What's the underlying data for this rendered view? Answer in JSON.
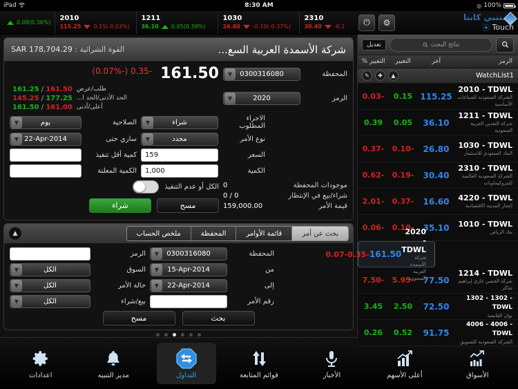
{
  "status_bar": {
    "device": "iPad",
    "wifi_icon": "wifi-icon",
    "time": "8:30 AM",
    "battery_text": "100%",
    "location_icon": "location-icon"
  },
  "ticker": {
    "items": [
      {
        "symbol": "",
        "last": "",
        "change": "0.08(0.36%)",
        "dir": "up"
      },
      {
        "symbol": "2010",
        "last": "115.25",
        "change": "0.15(-0.03%)",
        "dir": "down"
      },
      {
        "symbol": "1211",
        "last": "36.10",
        "change": "0.05(0.39%)",
        "dir": "up"
      },
      {
        "symbol": "1030",
        "last": "26.80",
        "change": "-0.10(-0.37%)",
        "dir": "down"
      },
      {
        "symbol": "2310",
        "last": "30.40",
        "change": "-0.1",
        "dir": "down"
      }
    ],
    "power_button": "⏻",
    "settings_button": "⚙",
    "brand_line1": "المتنبي كابنا",
    "brand_line2": "Touch"
  },
  "order_panel": {
    "title": "شركة الأسمدة العربية السع...",
    "buying_power_label": "القوة الشرائية :",
    "buying_power_value": "SAR 178,704.29",
    "quote": {
      "last": "161.50",
      "change": "-0.35 (-0.07%)",
      "bid_ask_label": "طلب/عرض",
      "bid": "161.25",
      "ask": "161.50",
      "limit_label": "الحد الأدنى/الحد ا...",
      "limit_low": "145.25",
      "limit_high": "177.25",
      "highlow_label": "أعلى/أدنى",
      "high": "161.50",
      "low": "161.00"
    },
    "fields": {
      "portfolio_label": "المحفظة",
      "portfolio_value": "0300316080",
      "symbol_label": "الرمز",
      "symbol_value": "2020",
      "action_label": "الاجراء المطلوب",
      "action_value": "شراء",
      "validity_label": "الصلاحية",
      "validity_value": "يوم",
      "order_type_label": "نوع الأمر",
      "order_type_value": "محدد",
      "valid_until_label": "ساري حتى",
      "valid_until_value": "22-Apr-2014",
      "price_label": "السعر",
      "price_value": "159",
      "min_qty_label": "كمية أقل تنفيذ",
      "min_qty_value": "",
      "qty_label": "الكمية",
      "qty_value": "1,000",
      "disclosed_qty_label": "الكمية المعلنة",
      "disclosed_qty_value": "",
      "all_or_none_label": "الكل أو عدم التنفيذ"
    },
    "summary": {
      "holdings_label": "موجودات المحفظة",
      "holdings_value": "0",
      "pending_label": "شراء/بيع في الإنتظار",
      "pending_value": "0 / 0",
      "order_value_label": "قيمة الأمر",
      "order_value_value": "159,000.00"
    },
    "buy_button": "شراء",
    "clear_button": "مسح"
  },
  "lower_panel": {
    "collapse_icon": "chevron-up-icon",
    "tabs": [
      {
        "label": "بحث عن أمر",
        "active": true
      },
      {
        "label": "قائمة الأوامر",
        "active": false
      },
      {
        "label": "المحفظة",
        "active": false
      },
      {
        "label": "ملخص الحساب",
        "active": false
      }
    ],
    "search": {
      "portfolio_label": "المحفظة",
      "portfolio_value": "0300316080",
      "symbol_label": "الرمز",
      "symbol_value": "",
      "from_label": "من",
      "from_value": "15-Apr-2014",
      "market_label": "السوق",
      "market_value": "الكل",
      "to_label": "إلى",
      "to_value": "22-Apr-2014",
      "status_label": "حالة الأمر",
      "status_value": "الكل",
      "order_no_label": "رقم الأمر",
      "order_no_value": "",
      "side_label": "بيع/شراء",
      "side_value": "الكل",
      "search_button": "بحث",
      "clear_button": "مسح"
    },
    "page_dots": {
      "count": 6,
      "active_index": 2
    }
  },
  "watchlist": {
    "search_icon": "search-icon",
    "search_placeholder": "نتائج البحث",
    "edit_button": "تعديل",
    "columns": {
      "symbol": "الرمز",
      "last": "آخر",
      "change": "التغيير",
      "change_pct": "التغيير %"
    },
    "group_name": "WatchList1",
    "group_icons": [
      "edit-pencil-icon",
      "plus-icon",
      "chevron-up-icon"
    ],
    "rows": [
      {
        "symbol": "2010 - TDWL",
        "name": "الشركة السعودية للصناعات الأساسية",
        "last": "115.25",
        "change": "0.15",
        "change_pct": "-0.03",
        "change_dir": "up",
        "pct_dir": "down",
        "selected": false
      },
      {
        "symbol": "1211 - TDWL",
        "name": "شركة التعدين العربية السعودية",
        "last": "36.10",
        "change": "0.05",
        "change_pct": "0.39",
        "change_dir": "up",
        "pct_dir": "up",
        "selected": false
      },
      {
        "symbol": "1030 - TDWL",
        "name": "البنك السعودي للاستثمار",
        "last": "26.80",
        "change": "-0.10",
        "change_pct": "-0.37",
        "change_dir": "down",
        "pct_dir": "down",
        "selected": false
      },
      {
        "symbol": "2310 - TDWL",
        "name": "الشركة السعودية العالمية للبتروكيماويات",
        "last": "30.40",
        "change": "-0.19",
        "change_pct": "-0.62",
        "change_dir": "down",
        "pct_dir": "down",
        "selected": false
      },
      {
        "symbol": "4220 - TDWL",
        "name": "إعمار المدينة الاقتصادية",
        "last": "16.60",
        "change": "-0.37",
        "change_pct": "-2.01",
        "change_dir": "down",
        "pct_dir": "down",
        "selected": false
      },
      {
        "symbol": "1010 - TDWL",
        "name": "بنك الرياض",
        "last": "35.10",
        "change": "-0.10",
        "change_pct": "-0.06",
        "change_dir": "down",
        "pct_dir": "down",
        "selected": false
      },
      {
        "symbol": "2020 - TDWL",
        "name": "شركة الأسمدة العربية السعودية",
        "last": "161.50",
        "change": "-0.35",
        "change_pct": "-0.07",
        "change_dir": "down",
        "pct_dir": "down",
        "selected": true
      },
      {
        "symbol": "1214 - TDWL",
        "name": "شركة الحسن غازي إبراهيم شاكر",
        "last": "77.50",
        "change": "-5.95",
        "change_pct": "-7.50",
        "change_dir": "down",
        "pct_dir": "down",
        "selected": false
      },
      {
        "symbol": "1302 - 1302 - TDWL",
        "name": "بوان القابضة",
        "last": "72.50",
        "change": "2.50",
        "change_pct": "3.45",
        "change_dir": "up",
        "pct_dir": "up",
        "selected": false
      },
      {
        "symbol": "4006 - 4006 - TDWL",
        "name": "الشركة السعودية للتسويق",
        "last": "91.75",
        "change": "0.52",
        "change_pct": "0.26",
        "change_dir": "up",
        "pct_dir": "up",
        "selected": false
      }
    ]
  },
  "bottom_nav": [
    {
      "label": "اعدادات",
      "icon": "gear-icon",
      "active": false
    },
    {
      "label": "مدير التنبيه",
      "icon": "bell-icon",
      "active": false
    },
    {
      "label": "التداول",
      "icon": "trade-arrows-icon",
      "active": true
    },
    {
      "label": "قوائم المتابعة",
      "icon": "up-down-arrows-icon",
      "active": false
    },
    {
      "label": "الأخبار",
      "icon": "microphone-icon",
      "active": false
    },
    {
      "label": "أعلى الأسهم",
      "icon": "bar-chart-up-icon",
      "active": false
    },
    {
      "label": "الأسواق",
      "icon": "market-chart-icon",
      "active": false
    }
  ],
  "colors": {
    "up": "#17b317",
    "down": "#d32222",
    "price_blue": "#2f86e8",
    "accent": "#3ba0ef",
    "buy_green": "#2d8a2d"
  }
}
